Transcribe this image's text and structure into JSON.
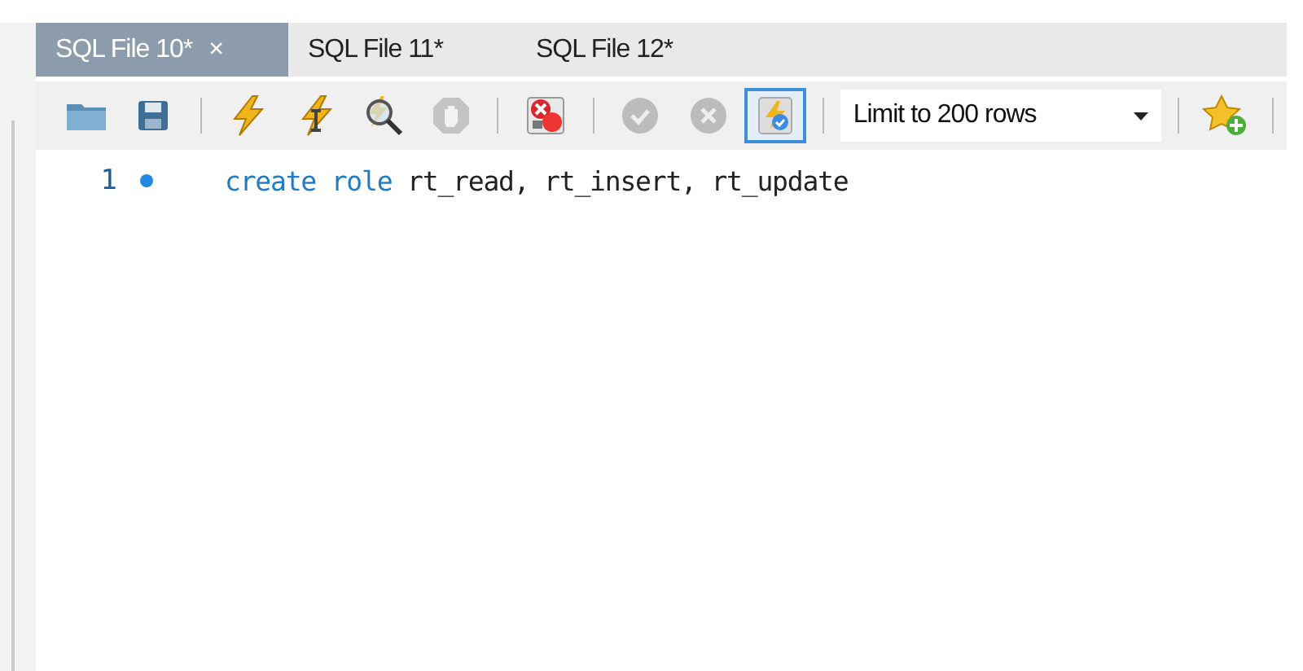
{
  "tabs": [
    {
      "label": "SQL File 10*",
      "selected": true,
      "close": "×"
    },
    {
      "label": "SQL File 11*",
      "selected": false
    },
    {
      "label": "SQL File 12*",
      "selected": false
    }
  ],
  "toolbar": [
    {
      "kind": "button",
      "disabled": false,
      "pressed": false
    },
    {
      "kind": "button",
      "disabled": false,
      "pressed": false
    },
    {
      "kind": "separator"
    },
    {
      "kind": "button",
      "disabled": false,
      "pressed": false
    },
    {
      "kind": "button",
      "disabled": false,
      "pressed": false
    },
    {
      "kind": "button",
      "disabled": false,
      "pressed": false
    },
    {
      "kind": "button",
      "disabled": true,
      "pressed": false
    },
    {
      "kind": "separator"
    },
    {
      "kind": "button",
      "disabled": false,
      "pressed": false
    },
    {
      "kind": "separator"
    },
    {
      "kind": "button",
      "disabled": true,
      "pressed": false
    },
    {
      "kind": "button",
      "disabled": true,
      "pressed": false
    },
    {
      "kind": "button",
      "disabled": false,
      "pressed": true
    },
    {
      "kind": "separator"
    },
    {
      "kind": "dropdown",
      "value": "Limit to 200 rows"
    },
    {
      "kind": "separator"
    },
    {
      "kind": "button",
      "disabled": false,
      "pressed": false
    },
    {
      "kind": "separator"
    }
  ],
  "editor": {
    "lines": [
      {
        "number": "1",
        "marker": true,
        "tokens": [
          {
            "text": "create",
            "kind": "keyword"
          },
          {
            "text": " role",
            "kind": "keyword"
          },
          {
            "text": " rt_read, rt_insert, rt_update",
            "kind": "plain"
          }
        ]
      }
    ]
  }
}
